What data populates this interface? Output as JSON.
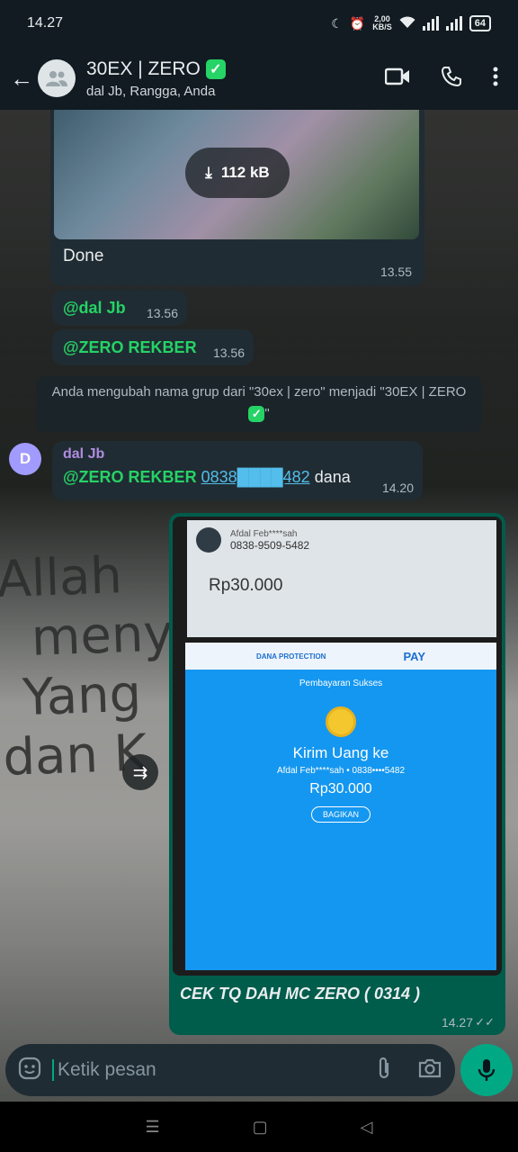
{
  "status_bar": {
    "time": "14.27",
    "net_speed_value": "2,00",
    "net_speed_unit": "KB/S",
    "battery": "64"
  },
  "header": {
    "title": "30EX | ZERO",
    "subtitle": "dal Jb, Rangga, Anda"
  },
  "messages": {
    "image": {
      "size": "112 kB",
      "caption": "Done",
      "time": "13.55"
    },
    "mention1": {
      "text": "@dal Jb",
      "time": "13.56"
    },
    "mention2": {
      "text": "@ZERO REKBER",
      "time": "13.56"
    },
    "system": {
      "text": "Anda mengubah nama grup dari \"30ex | zero\" menjadi \"30EX | ZERO",
      "suffix": "\""
    },
    "reply": {
      "avatar_letter": "D",
      "sender": "dal Jb",
      "mention": "@ZERO REKBER",
      "phone": "0838████482",
      "text": "dana",
      "time": "14.20"
    },
    "photo": {
      "shot": {
        "name": "Afdal Feb****sah",
        "number": "0838-9509-5482",
        "amount_top": "Rp30.000",
        "dana_protection": "DANA PROTECTION",
        "pay": "PAY",
        "status": "Pembayaran Sukses",
        "title": "Kirim Uang ke",
        "recipient": "Afdal Feb****sah • 0838••••5482",
        "amount": "Rp30.000",
        "share": "BAGIKAN"
      },
      "caption": "CEK TQ DAH MC ZERO ( 0314 )",
      "time": "14.27"
    }
  },
  "wall_text": {
    "line1": "Allah",
    "line2": "menyu",
    "line3": "Yang",
    "line4": "dan K"
  },
  "input": {
    "placeholder": "Ketik pesan"
  }
}
